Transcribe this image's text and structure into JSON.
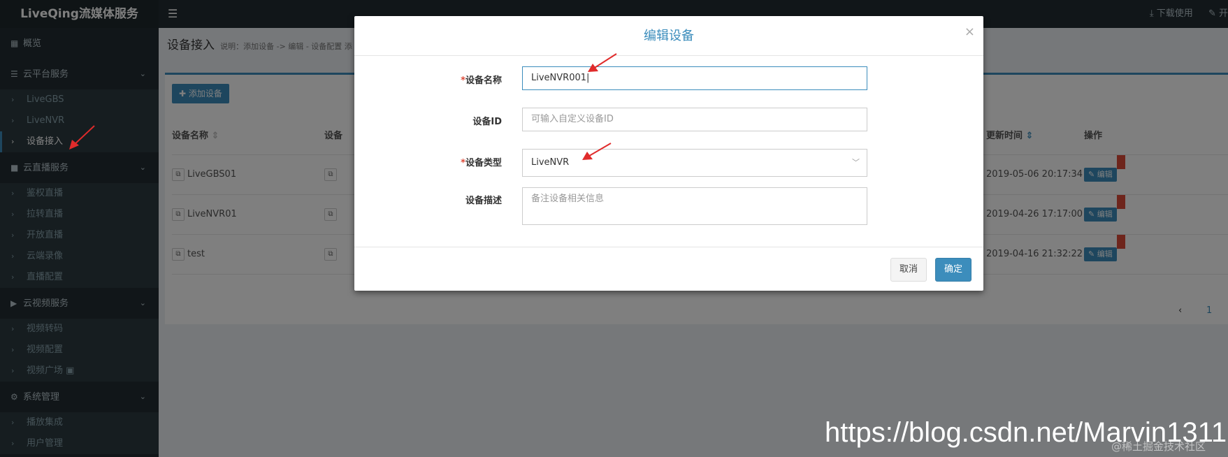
{
  "topbar": {
    "brand": "LiveQing流媒体服务",
    "links": [
      "下载使用",
      "开"
    ]
  },
  "sidebar": {
    "overview": "概览",
    "groups": [
      {
        "label": "云平台服务",
        "items": [
          "LiveGBS",
          "LiveNVR",
          "设备接入"
        ]
      },
      {
        "label": "云直播服务",
        "items": [
          "鉴权直播",
          "拉转直播",
          "开放直播",
          "云端录像",
          "直播配置"
        ]
      },
      {
        "label": "云视频服务",
        "items": [
          "视频转码",
          "视频配置",
          "视频广场"
        ]
      },
      {
        "label": "系统管理",
        "items": [
          "播放集成",
          "用户管理"
        ]
      }
    ]
  },
  "page": {
    "title": "设备接入",
    "subtitle": "说明：添加设备 -> 编辑 - 设备配置 添",
    "add_button": "添加设备"
  },
  "table": {
    "headers": [
      "设备名称",
      "设备",
      "更新时间",
      "操作"
    ],
    "rows": [
      {
        "name": "LiveGBS01",
        "updated": "2019-05-06 20:17:34",
        "action": "编辑"
      },
      {
        "name": "LiveNVR01",
        "updated": "2019-04-26 17:17:00",
        "action": "编辑"
      },
      {
        "name": "test",
        "updated": "2019-04-16 21:32:22",
        "action": "编辑"
      }
    ],
    "pager": {
      "prev": "‹",
      "current": "1"
    }
  },
  "modal": {
    "title": "编辑设备",
    "close": "×",
    "fields": {
      "name_label": "设备名称",
      "name_value": "LiveNVR001",
      "id_label": "设备ID",
      "id_placeholder": "可输入自定义设备ID",
      "type_label": "设备类型",
      "type_value": "LiveNVR",
      "desc_label": "设备描述",
      "desc_placeholder": "备注设备相关信息"
    },
    "cancel": "取消",
    "ok": "确定"
  },
  "watermark": {
    "url": "https://blog.csdn.net/Marvin1311",
    "sub": "@稀土掘金技术社区"
  },
  "colors": {
    "accent": "#3c8dbc",
    "sidebar_bg": "#222d32",
    "annotation": "#e02b2b"
  }
}
